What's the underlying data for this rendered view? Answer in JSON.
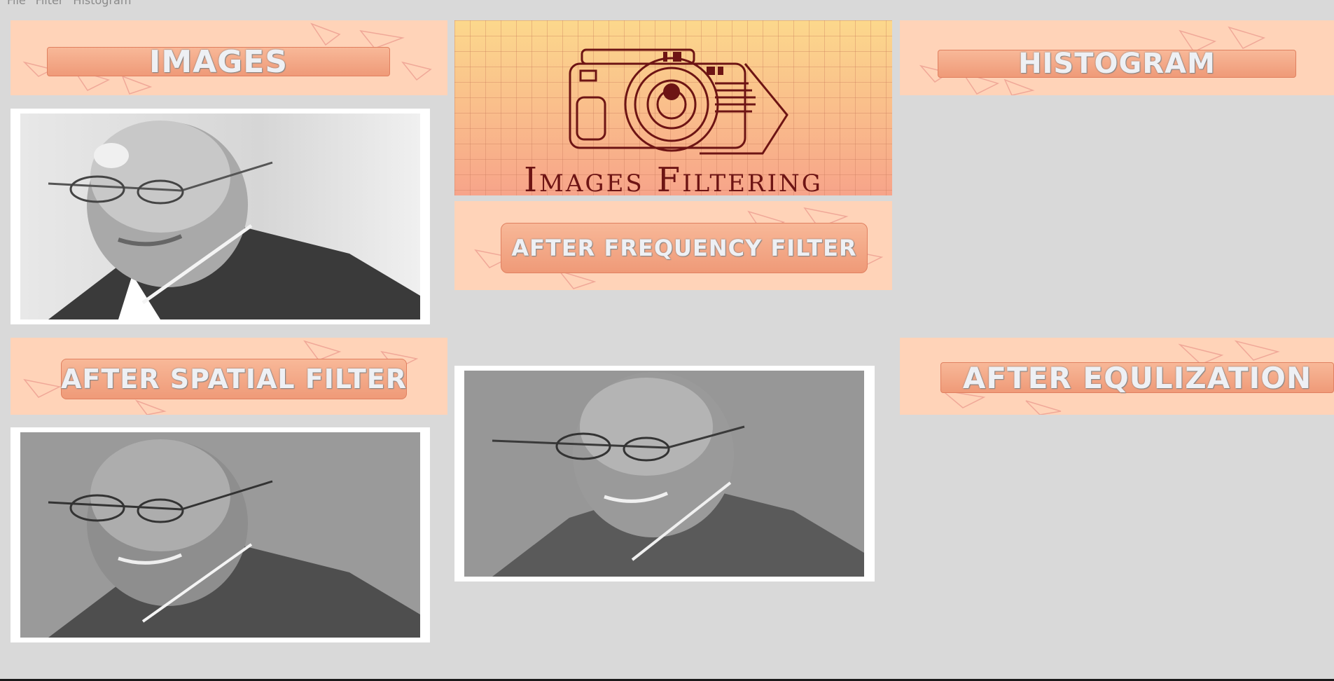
{
  "menu": {
    "file": "File",
    "filter": "Filter",
    "histogram": "Histogram"
  },
  "panels": {
    "images_label": "IMAGES",
    "histogram_label": "HISTOGRAM",
    "frequency_label": "AFTER FREQUENCY FILTER",
    "spatial_label": "AFTER SPATIAL FILTER",
    "equalization_label": "AFTER EQULIZATION"
  },
  "logo": {
    "title": "Images Filtering",
    "icon": "camera-icon"
  },
  "colors": {
    "background": "#d9d9d9",
    "banner": "#ffd3b8",
    "label_box": "#f0a07e",
    "logo_ink": "#6d1414"
  }
}
